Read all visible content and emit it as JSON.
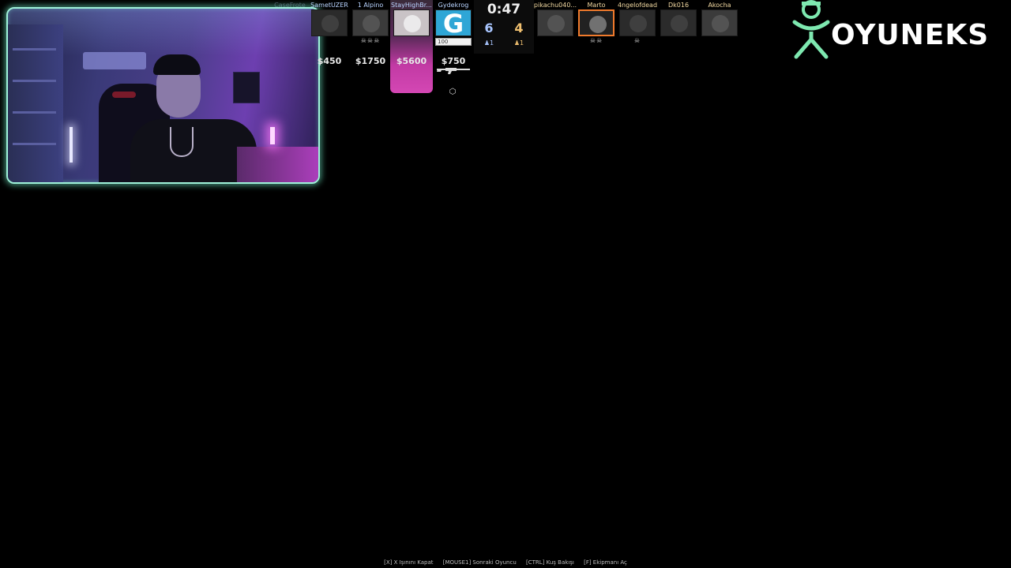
{
  "scoreboard": {
    "timer": "0:47",
    "ct_score": "6",
    "t_score": "4",
    "ct_alive": "1",
    "t_alive": "1",
    "ct_players": [
      {
        "name": "CaseFrote"
      },
      {
        "name": "SametUZER",
        "money": "$450"
      },
      {
        "name": "1 Alpino",
        "money": "$1750",
        "kills": "☠☠☠"
      },
      {
        "name": "StayHighBr...",
        "money": "$5600"
      },
      {
        "name": "Gydekrog",
        "money": "$750",
        "health": "100",
        "logo_letter": "G"
      }
    ],
    "t_players": [
      {
        "name": "pikachu040..."
      },
      {
        "name": "Marto",
        "kills": "☠☠"
      },
      {
        "name": "4ngelofdead",
        "kills": "☠"
      },
      {
        "name": "Dk016"
      },
      {
        "name": "Akocha"
      }
    ]
  },
  "brand": {
    "name": "OYUNEKS",
    "accent_color": "#7ee8b0"
  },
  "hints": [
    "[X] X Işınını Kapat",
    "[MOUSE1] Sonraki Oyuncu",
    "[CTRL] Kuş Bakışı",
    "[F] Ekipmanı Aç"
  ],
  "icons": {
    "weapon": "rifle-icon",
    "defuse": "defuse-kit-icon",
    "alive": "person-icon",
    "kill": "skull-icon"
  }
}
